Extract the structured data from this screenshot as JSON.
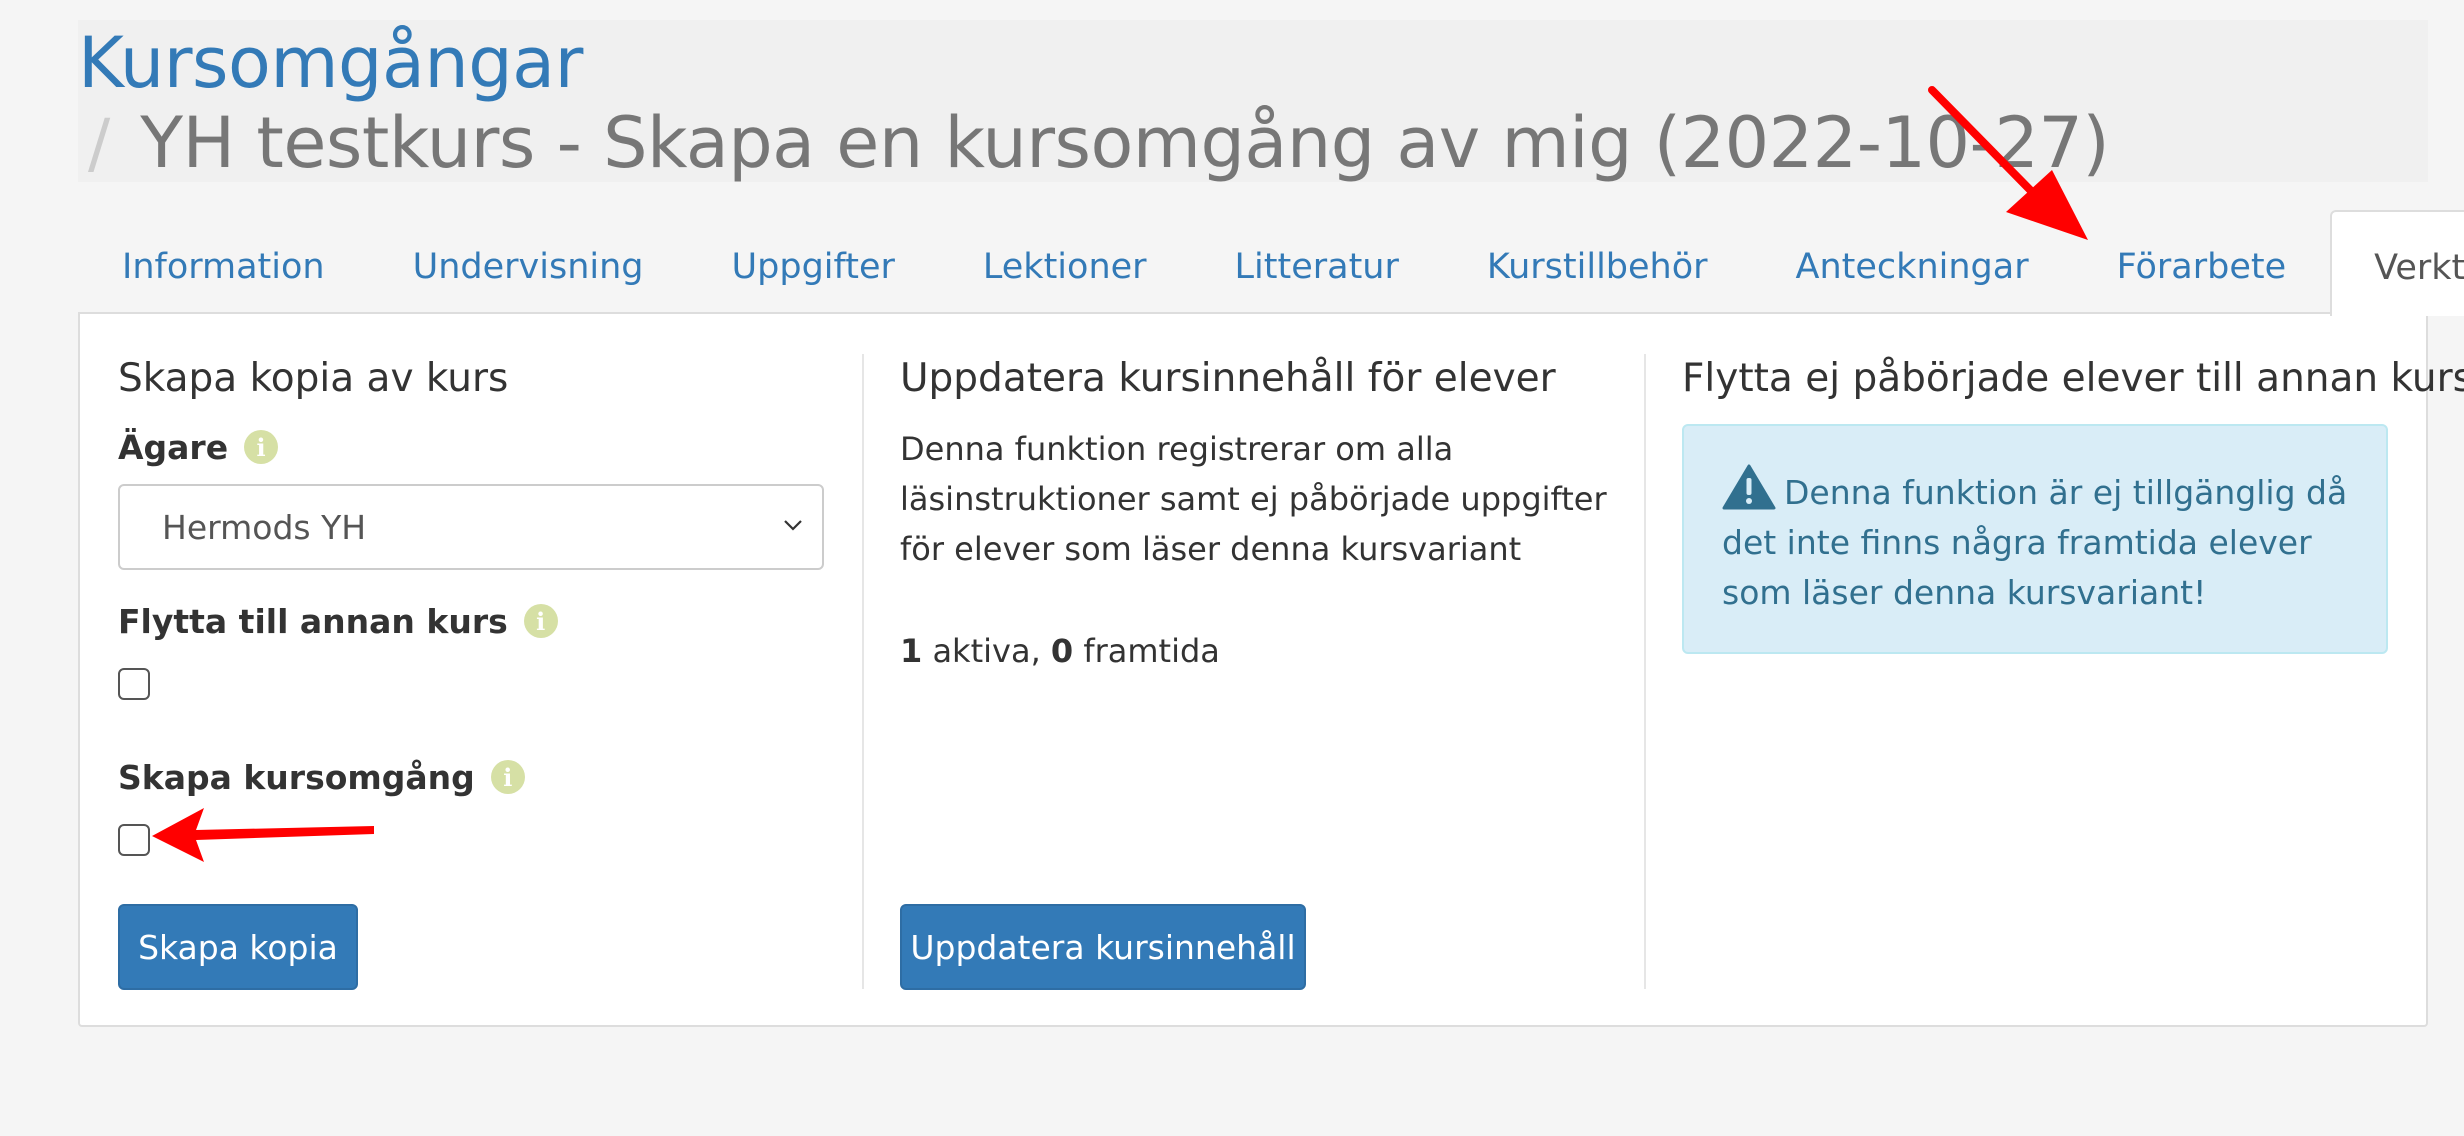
{
  "header": {
    "title": "Kursomgångar",
    "breadcrumb_separator": "/",
    "breadcrumb_current": "YH testkurs - Skapa en kursomgång av mig (2022-10-27)"
  },
  "tabs": [
    {
      "label": "Information",
      "active": false
    },
    {
      "label": "Undervisning",
      "active": false
    },
    {
      "label": "Uppgifter",
      "active": false
    },
    {
      "label": "Lektioner",
      "active": false
    },
    {
      "label": "Litteratur",
      "active": false
    },
    {
      "label": "Kurstillbehör",
      "active": false
    },
    {
      "label": "Anteckningar",
      "active": false
    },
    {
      "label": "Förarbete",
      "active": false
    },
    {
      "label": "Verktyg",
      "active": true
    }
  ],
  "copy_section": {
    "title": "Skapa kopia av kurs",
    "owner_label": "Ägare",
    "owner_value": "Hermods YH",
    "move_label": "Flytta till annan kurs",
    "move_checked": false,
    "create_round_label": "Skapa kursomgång",
    "create_round_checked": false,
    "button_label": "Skapa kopia"
  },
  "update_section": {
    "title": "Uppdatera kursinnehåll för elever",
    "description": "Denna funktion registrerar om alla läsinstruktioner samt ej påbörjade uppgifter för elever som läser denna kursvariant",
    "active_count": "1",
    "active_text": " aktiva, ",
    "future_count": "0",
    "future_text": " framtida",
    "button_label": "Uppdatera kursinnehåll"
  },
  "move_section": {
    "title": "Flytta ej påbörjade elever till annan kurs",
    "alert_text": "Denna funktion är ej tillgänglig då det inte finns några framtida elever som läser denna kursvariant!"
  },
  "icons": {
    "info": "info-icon",
    "warning": "warning-icon",
    "chevron": "chevron-down-icon"
  },
  "colors": {
    "link_blue": "#337ab7",
    "alert_bg": "#d9edf7",
    "alert_text": "#31708f",
    "info_icon": "#d6e0a5",
    "annotation_arrow": "#ff0000"
  }
}
